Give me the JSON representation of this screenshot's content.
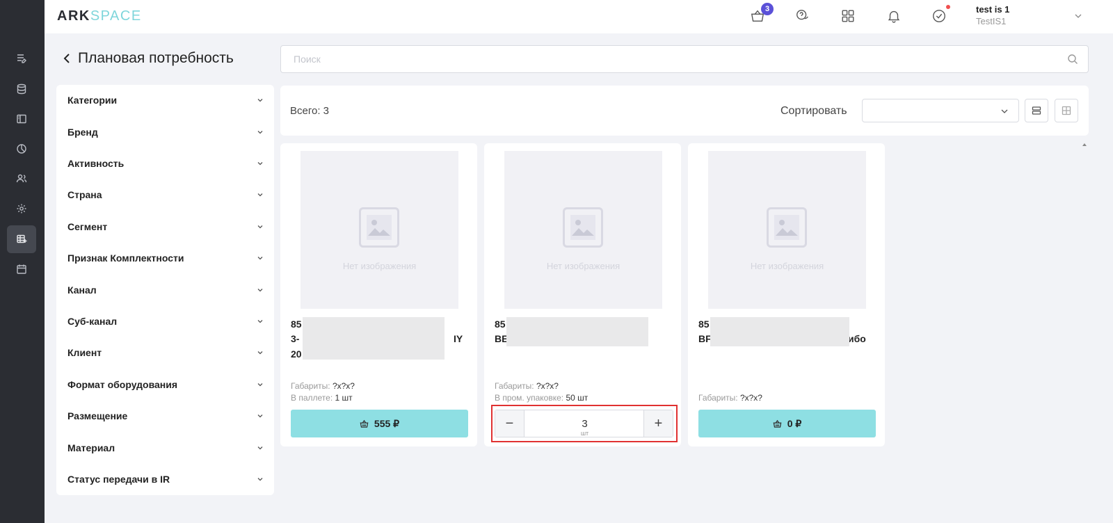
{
  "app": {
    "logo_part1": "ARK",
    "logo_part2": "SPACE"
  },
  "header": {
    "cart_count": "3",
    "user_name": "test is 1",
    "user_sub": "TestIS1",
    "icons": [
      "cart-icon",
      "help-chat-icon",
      "apps-grid-icon",
      "bell-icon",
      "check-circle-icon"
    ]
  },
  "sidebar": {
    "icons": [
      "list-edit-icon",
      "database-icon",
      "layout-icon",
      "pie-chart-icon",
      "users-icon",
      "gear-icon",
      "table-add-icon",
      "calendar-icon"
    ],
    "active_index": 6
  },
  "page": {
    "title": "Плановая потребность"
  },
  "search": {
    "placeholder": "Поиск"
  },
  "filters": [
    {
      "label": "Категории"
    },
    {
      "label": "Бренд"
    },
    {
      "label": "Активность"
    },
    {
      "label": "Страна"
    },
    {
      "label": "Сегмент"
    },
    {
      "label": "Признак Комплектности"
    },
    {
      "label": "Канал"
    },
    {
      "label": "Суб-канал"
    },
    {
      "label": "Клиент"
    },
    {
      "label": "Формат оборудования"
    },
    {
      "label": "Размещение"
    },
    {
      "label": "Материал"
    },
    {
      "label": "Статус передачи в IR"
    }
  ],
  "toolbar": {
    "total": "Всего: 3",
    "sort_label": "Сортировать",
    "sort_value": ""
  },
  "products": [
    {
      "no_image": "Нет изображения",
      "title_lines": [
        "85",
        "3-",
        "20"
      ],
      "title_tail": "IY",
      "dims_label": "Габариты:",
      "dims_value": "?x?x?",
      "pack_label": "В паллете:",
      "pack_value": "1 шт",
      "price": "555 ₽"
    },
    {
      "no_image": "Нет изображения",
      "title_lines": [
        "85",
        "BE"
      ],
      "dims_label": "Габариты:",
      "dims_value": "?x?x?",
      "pack_label": "В пром. упаковке:",
      "pack_value": "50 шт",
      "qty_value": "3",
      "qty_unit": "шт",
      "minus": "−",
      "plus": "+"
    },
    {
      "no_image": "Нет изображения",
      "title_lines": [
        "85",
        "BF"
      ],
      "title_tail": "ибо",
      "dims_label": "Габариты:",
      "dims_value": "?x?x?",
      "price": "0 ₽"
    }
  ],
  "colors": {
    "accent": "#8edfe3",
    "badge": "#5b51d8",
    "highlight": "#e03131",
    "rail": "#2b2d33"
  }
}
